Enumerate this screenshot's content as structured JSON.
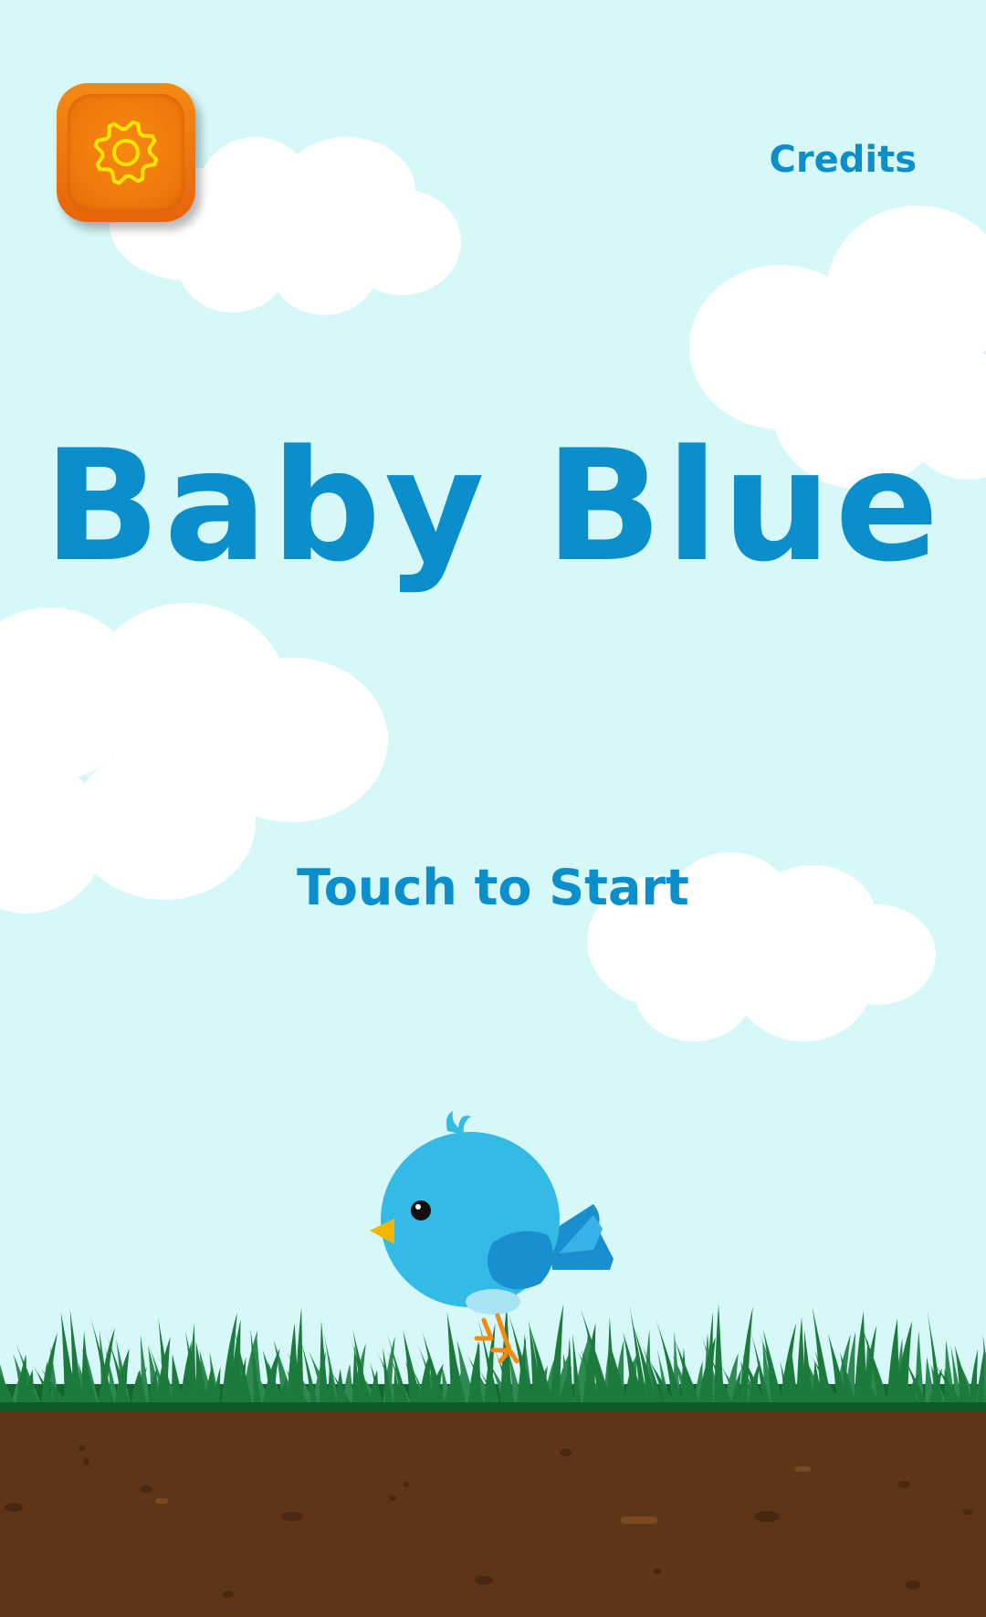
{
  "game": {
    "title": "Baby Blue",
    "prompt": "Touch to Start",
    "credits_label": "Credits"
  },
  "icons": {
    "settings": "gear-icon"
  },
  "colors": {
    "sky": "#d6f8f8",
    "title_text": "#0a8ecc",
    "settings_button": "#f07a0c",
    "gear": "#ffe600",
    "bird_body": "#33bbe6",
    "grass": "#1c7a3c",
    "dirt": "#5e3516"
  }
}
